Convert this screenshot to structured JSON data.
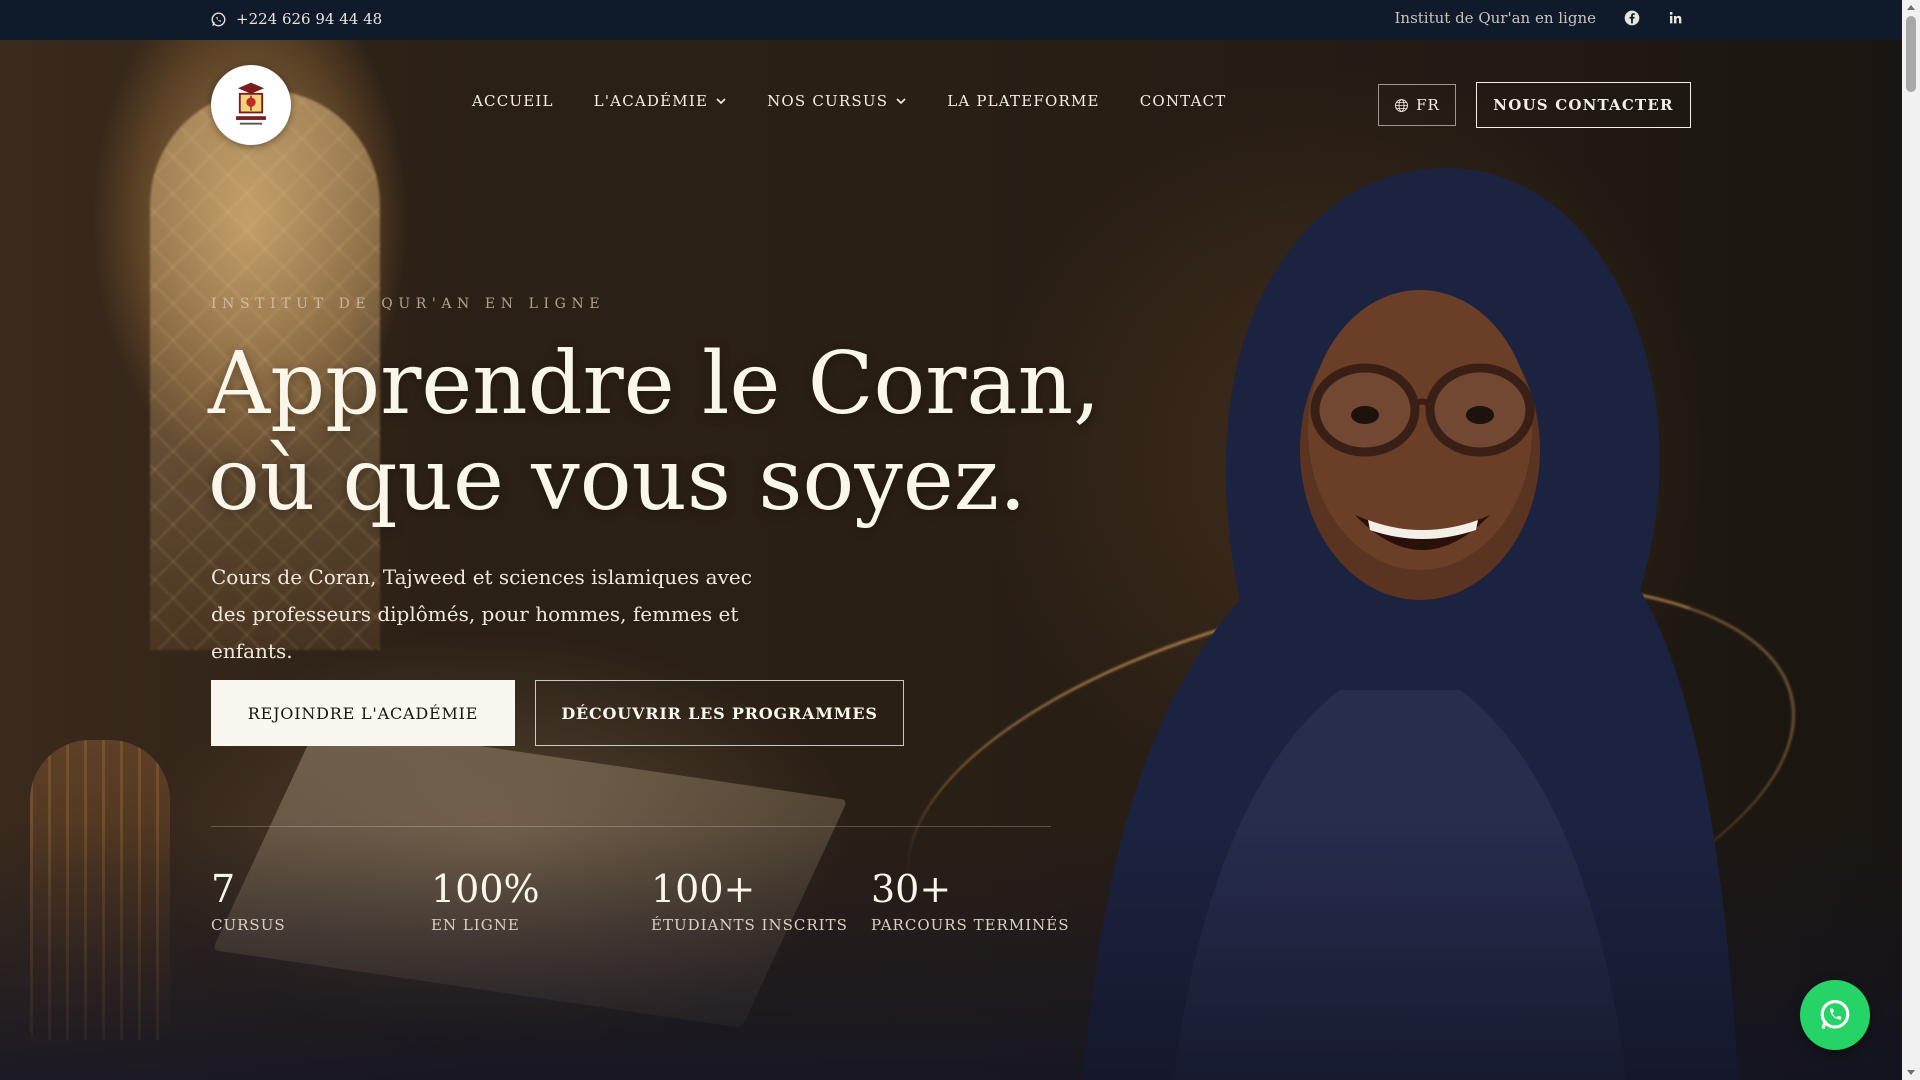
{
  "topbar": {
    "phone": "+224 626 94 44 48",
    "phone_icon": "whatsapp-icon",
    "tagline": "Institut de Qur'an en ligne",
    "social": [
      "facebook-icon",
      "linkedin-icon"
    ]
  },
  "nav": {
    "items": [
      {
        "label": "ACCUEIL",
        "dropdown": false
      },
      {
        "label": "L'ACADÉMIE",
        "dropdown": true
      },
      {
        "label": "NOS CURSUS",
        "dropdown": true
      },
      {
        "label": "LA PLATEFORME",
        "dropdown": false
      },
      {
        "label": "CONTACT",
        "dropdown": false
      }
    ],
    "language": "FR",
    "contact_button": "NOUS CONTACTER"
  },
  "hero": {
    "eyebrow": "INSTITUT DE QUR'AN EN LIGNE",
    "headline_line1": "Apprendre le Coran,",
    "headline_line2": "où que vous soyez.",
    "subtext": "Cours de Coran, Tajweed et sciences islamiques avec des professeurs diplômés, pour hommes, femmes et enfants.",
    "primary_button": "REJOINDRE L'ACADÉMIE",
    "secondary_button": "DÉCOUVRIR LES PROGRAMMES"
  },
  "stats": [
    {
      "value": "7",
      "label": "CURSUS"
    },
    {
      "value": "100%",
      "label": "EN LIGNE"
    },
    {
      "value": "100+",
      "label": "ÉTUDIANTS INSCRITS"
    },
    {
      "value": "30+",
      "label": "PARCOURS TERMINÉS"
    }
  ],
  "colors": {
    "topbar_bg": "#0f1a2b",
    "whatsapp_green": "#25d366",
    "cream": "#faf7ef"
  }
}
